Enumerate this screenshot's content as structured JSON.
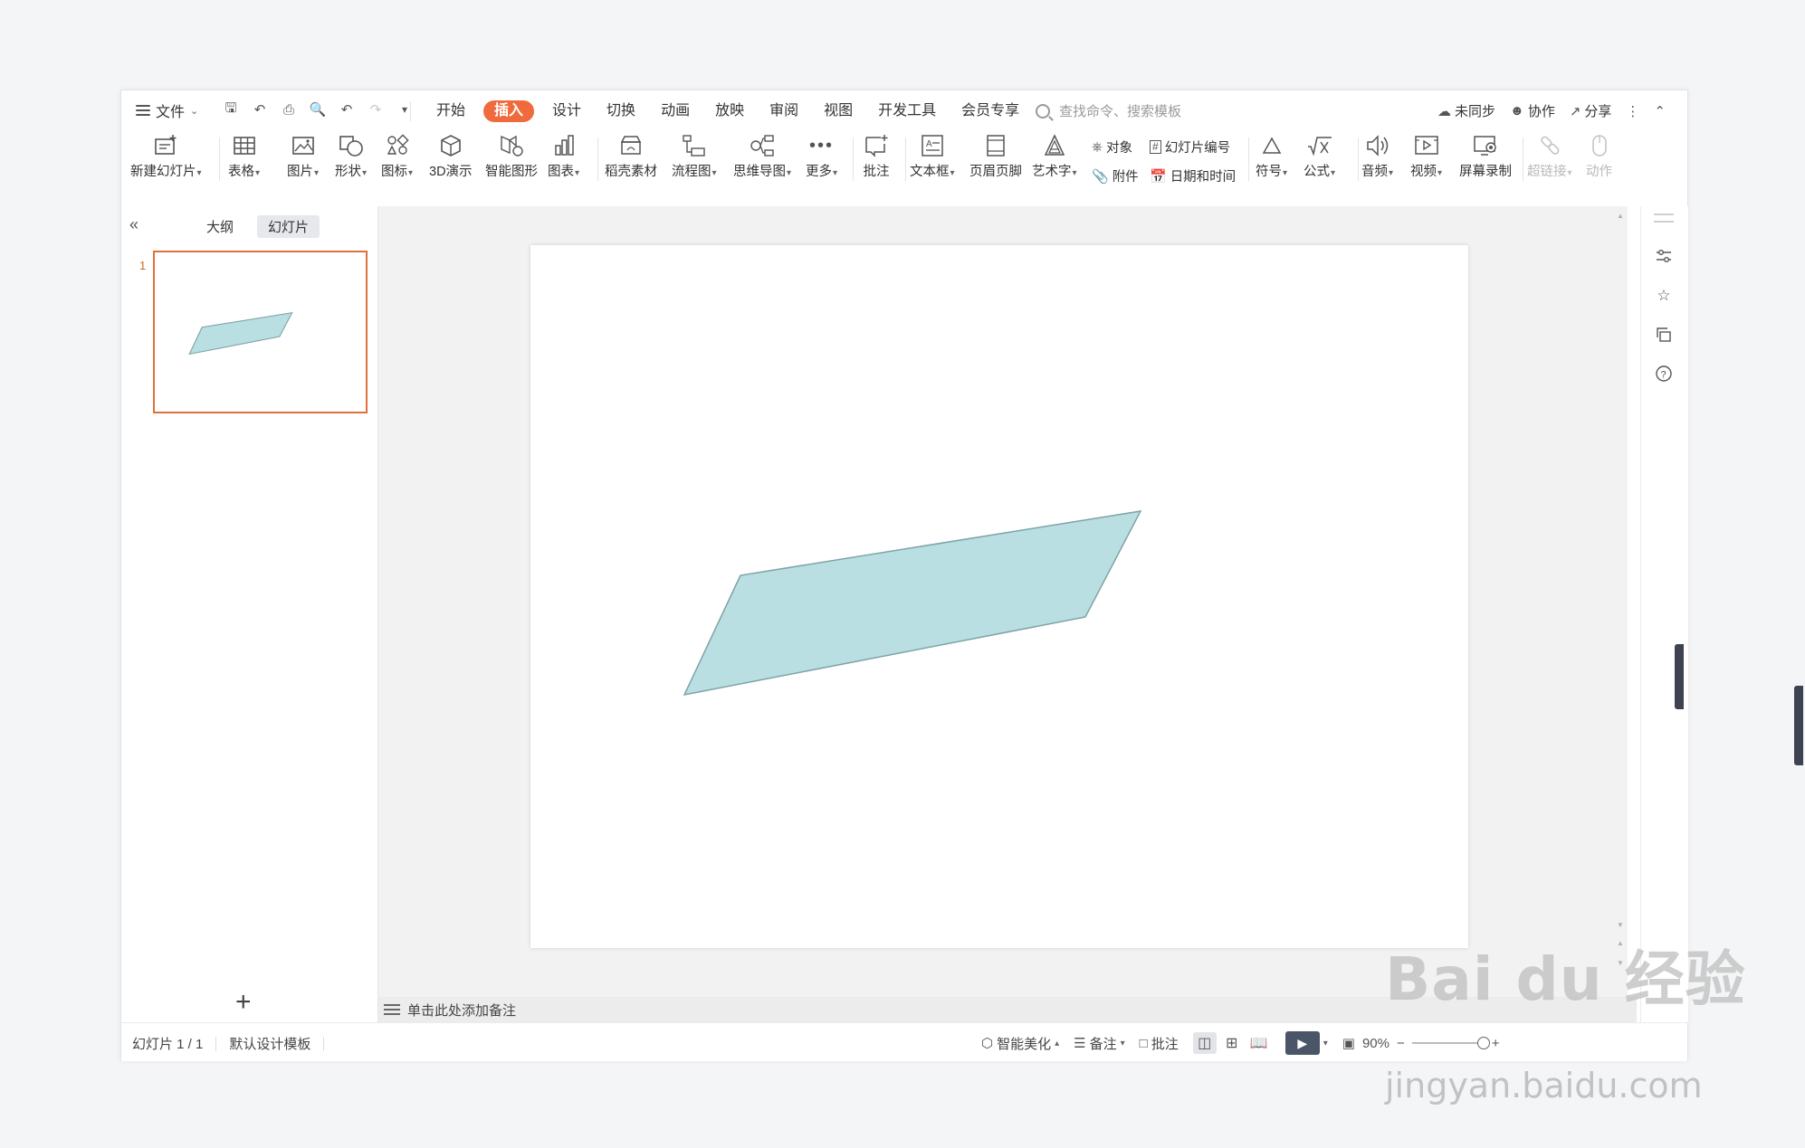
{
  "menubar": {
    "file_label": "文件",
    "tabs": [
      "开始",
      "插入",
      "设计",
      "切换",
      "动画",
      "放映",
      "审阅",
      "视图",
      "开发工具",
      "会员专享"
    ],
    "active_tab": "插入",
    "search_placeholder": "查找命令、搜索模板",
    "sync_label": "未同步",
    "collab_label": "协作",
    "share_label": "分享"
  },
  "ribbon": {
    "new_slide": "新建幻灯片",
    "table": "表格",
    "picture": "图片",
    "shape": "形状",
    "icon": "图标",
    "demo3d": "3D演示",
    "smart_graphic": "智能图形",
    "chart": "图表",
    "docer_material": "稻壳素材",
    "flowchart": "流程图",
    "mindmap": "思维导图",
    "more": "更多",
    "comment": "批注",
    "textbox": "文本框",
    "header_footer": "页眉页脚",
    "wordart": "艺术字",
    "object": "对象",
    "slide_number": "幻灯片编号",
    "attachment": "附件",
    "date_time": "日期和时间",
    "symbol": "符号",
    "formula": "公式",
    "audio": "音频",
    "video": "视频",
    "screen_record": "屏幕录制",
    "hyperlink": "超链接",
    "action": "动作"
  },
  "left_panel": {
    "tab_outline": "大纲",
    "tab_slides": "幻灯片",
    "active_tab": "幻灯片",
    "slide_numbers": [
      "1"
    ]
  },
  "slide": {
    "shape_type": "parallelogram",
    "fill_color": "#b9dfe2",
    "stroke_color": "#7fa3a6"
  },
  "notes": {
    "placeholder": "单击此处添加备注"
  },
  "status": {
    "slide_counter": "幻灯片 1 / 1",
    "template": "默认设计模板",
    "beautify": "智能美化",
    "notes": "备注",
    "comment": "批注",
    "zoom": "90%"
  },
  "watermark": {
    "logo": "Bai du 经验",
    "url": "jingyan.baidu.com"
  },
  "colors": {
    "accent": "#ef6a3c",
    "thumb_border": "#e0703c",
    "play_button": "#4a5667"
  }
}
